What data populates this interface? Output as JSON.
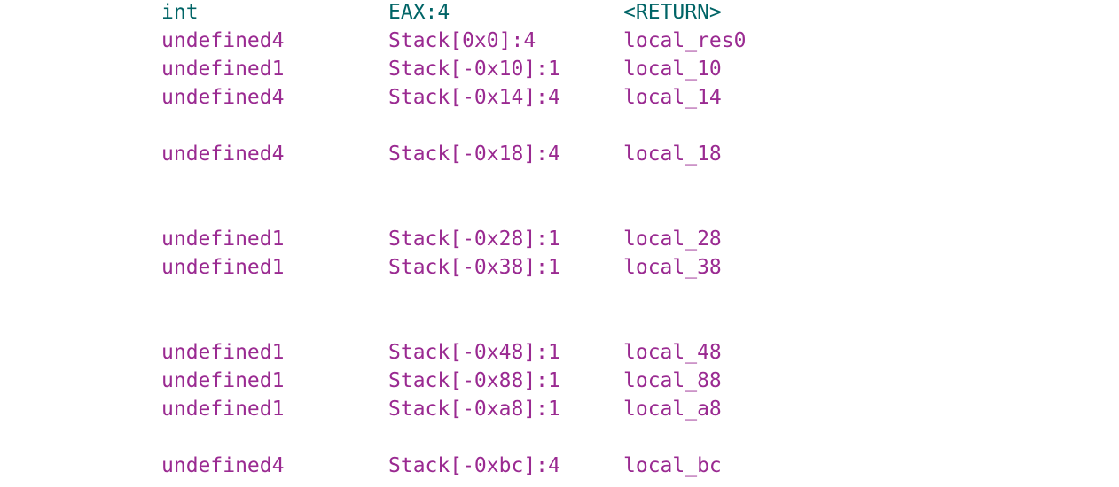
{
  "colors": {
    "return_value": "#006466",
    "stack_variable": "#9a2a91",
    "background": "#ffffff"
  },
  "variables": [
    {
      "type": "int",
      "storage": "EAX:4",
      "name": "<RETURN>",
      "kind": "return_value"
    },
    {
      "type": "undefined4",
      "storage": "Stack[0x0]:4",
      "name": "local_res0",
      "kind": "stack_variable"
    },
    {
      "type": "undefined1",
      "storage": "Stack[-0x10]:1",
      "name": "local_10",
      "kind": "stack_variable"
    },
    {
      "type": "undefined4",
      "storage": "Stack[-0x14]:4",
      "name": "local_14",
      "kind": "stack_variable"
    },
    {
      "type": "undefined4",
      "storage": "Stack[-0x18]:4",
      "name": "local_18",
      "kind": "stack_variable"
    },
    {
      "type": "undefined1",
      "storage": "Stack[-0x28]:1",
      "name": "local_28",
      "kind": "stack_variable"
    },
    {
      "type": "undefined1",
      "storage": "Stack[-0x38]:1",
      "name": "local_38",
      "kind": "stack_variable"
    },
    {
      "type": "undefined1",
      "storage": "Stack[-0x48]:1",
      "name": "local_48",
      "kind": "stack_variable"
    },
    {
      "type": "undefined1",
      "storage": "Stack[-0x88]:1",
      "name": "local_88",
      "kind": "stack_variable"
    },
    {
      "type": "undefined1",
      "storage": "Stack[-0xa8]:1",
      "name": "local_a8",
      "kind": "stack_variable"
    },
    {
      "type": "undefined4",
      "storage": "Stack[-0xbc]:4",
      "name": "local_bc",
      "kind": "stack_variable"
    }
  ]
}
